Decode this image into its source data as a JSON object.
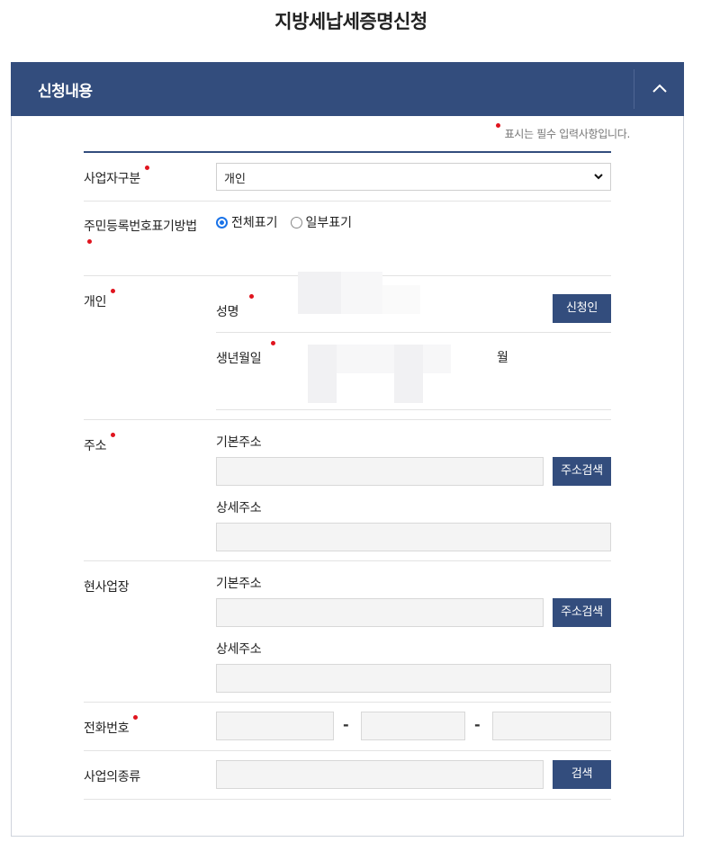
{
  "page": {
    "title": "지방세납세증명신청"
  },
  "panel": {
    "title": "신청내용",
    "toggle_icon": "chevron-up-icon",
    "required_note": "표시는 필수 입력사항입니다."
  },
  "form": {
    "business_type": {
      "label": "사업자구분",
      "selected": "개인"
    },
    "rrn_display": {
      "label": "주민등록번호표기방법",
      "options": [
        "전체표기",
        "일부표기"
      ],
      "selected": "전체표기"
    },
    "individual": {
      "label": "개인",
      "name_label": "성명",
      "applicant_button": "신청인",
      "birth_label": "생년월일",
      "month_unit": "월"
    },
    "address": {
      "label": "주소",
      "basic_label": "기본주소",
      "search_button": "주소검색",
      "detail_label": "상세주소"
    },
    "business_site": {
      "label": "현사업장",
      "basic_label": "기본주소",
      "search_button": "주소검색",
      "detail_label": "상세주소"
    },
    "phone": {
      "label": "전화번호",
      "separator": "-"
    },
    "business_kind": {
      "label": "사업의종류",
      "search_button": "검색"
    }
  },
  "colors": {
    "primary": "#334d7d",
    "required_dot": "#e0141e",
    "input_bg": "#f4f4f4"
  }
}
